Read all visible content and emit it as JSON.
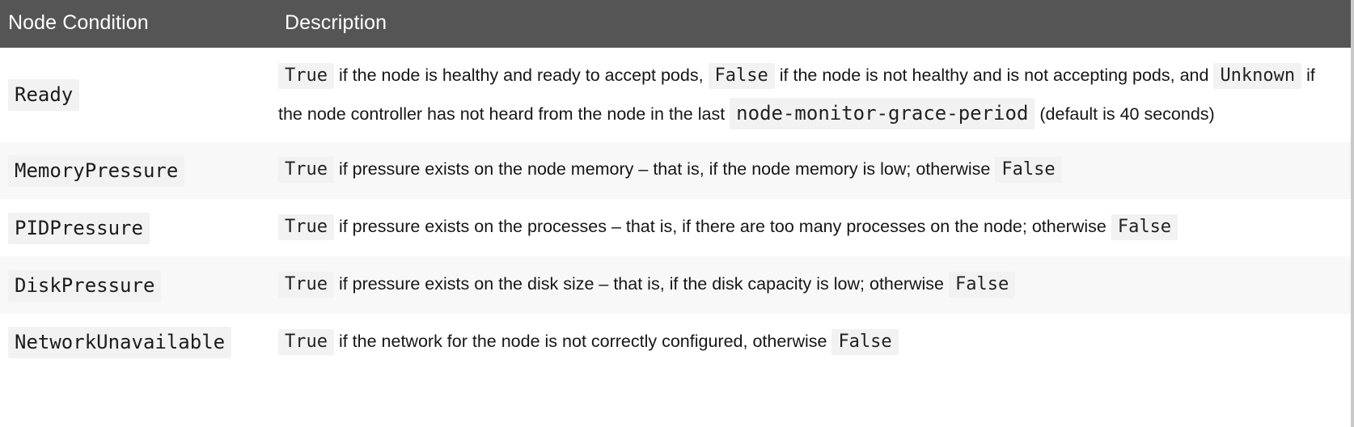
{
  "table": {
    "columns": [
      {
        "key": "condition",
        "label": "Node Condition"
      },
      {
        "key": "description",
        "label": "Description"
      }
    ],
    "colors": {
      "header_background": "#555555",
      "header_text": "#ffffff",
      "row_background": "#ffffff",
      "row_background_striped": "#f8f8f8",
      "code_background": "#f2f2f2",
      "code_text": "#222222",
      "body_text": "#1a1a1a",
      "right_border": "#c9c9c9"
    },
    "rows": [
      {
        "condition": "Ready",
        "striped": false,
        "description_plain": "True if the node is healthy and ready to accept pods, False if the node is not healthy and is not accepting pods, and Unknown if the node controller has not heard from the node in the last node-monitor-grace-period (default is 40 seconds)",
        "segments": [
          {
            "type": "code",
            "text": "True"
          },
          {
            "type": "text",
            "text": " if the node is healthy and ready to accept pods, "
          },
          {
            "type": "code",
            "text": "False"
          },
          {
            "type": "text",
            "text": " if the node is not healthy and is not accepting pods, and "
          },
          {
            "type": "code",
            "text": "Unknown"
          },
          {
            "type": "text",
            "text": " if the node controller has not heard from the node in the last "
          },
          {
            "type": "code-lg",
            "text": "node-monitor-grace-period"
          },
          {
            "type": "text",
            "text": " (default is 40 seconds)"
          }
        ]
      },
      {
        "condition": "MemoryPressure",
        "striped": true,
        "description_plain": "True if pressure exists on the node memory – that is, if the node memory is low; otherwise False",
        "segments": [
          {
            "type": "code",
            "text": "True"
          },
          {
            "type": "text",
            "text": " if pressure exists on the node memory – that is, if the node memory is low; otherwise "
          },
          {
            "type": "code",
            "text": "False"
          }
        ]
      },
      {
        "condition": "PIDPressure",
        "striped": false,
        "description_plain": "True if pressure exists on the processes – that is, if there are too many processes on the node; otherwise False",
        "segments": [
          {
            "type": "code",
            "text": "True"
          },
          {
            "type": "text",
            "text": " if pressure exists on the processes – that is, if there are too many processes on the node; otherwise "
          },
          {
            "type": "code",
            "text": "False"
          }
        ]
      },
      {
        "condition": "DiskPressure",
        "striped": true,
        "description_plain": "True if pressure exists on the disk size – that is, if the disk capacity is low; otherwise False",
        "segments": [
          {
            "type": "code",
            "text": "True"
          },
          {
            "type": "text",
            "text": " if pressure exists on the disk size – that is, if the disk capacity is low; otherwise "
          },
          {
            "type": "code",
            "text": "False"
          }
        ]
      },
      {
        "condition": "NetworkUnavailable",
        "striped": false,
        "description_plain": "True if the network for the node is not correctly configured, otherwise False",
        "segments": [
          {
            "type": "code",
            "text": "True"
          },
          {
            "type": "text",
            "text": " if the network for the node is not correctly configured, otherwise "
          },
          {
            "type": "code",
            "text": "False"
          }
        ]
      }
    ]
  }
}
